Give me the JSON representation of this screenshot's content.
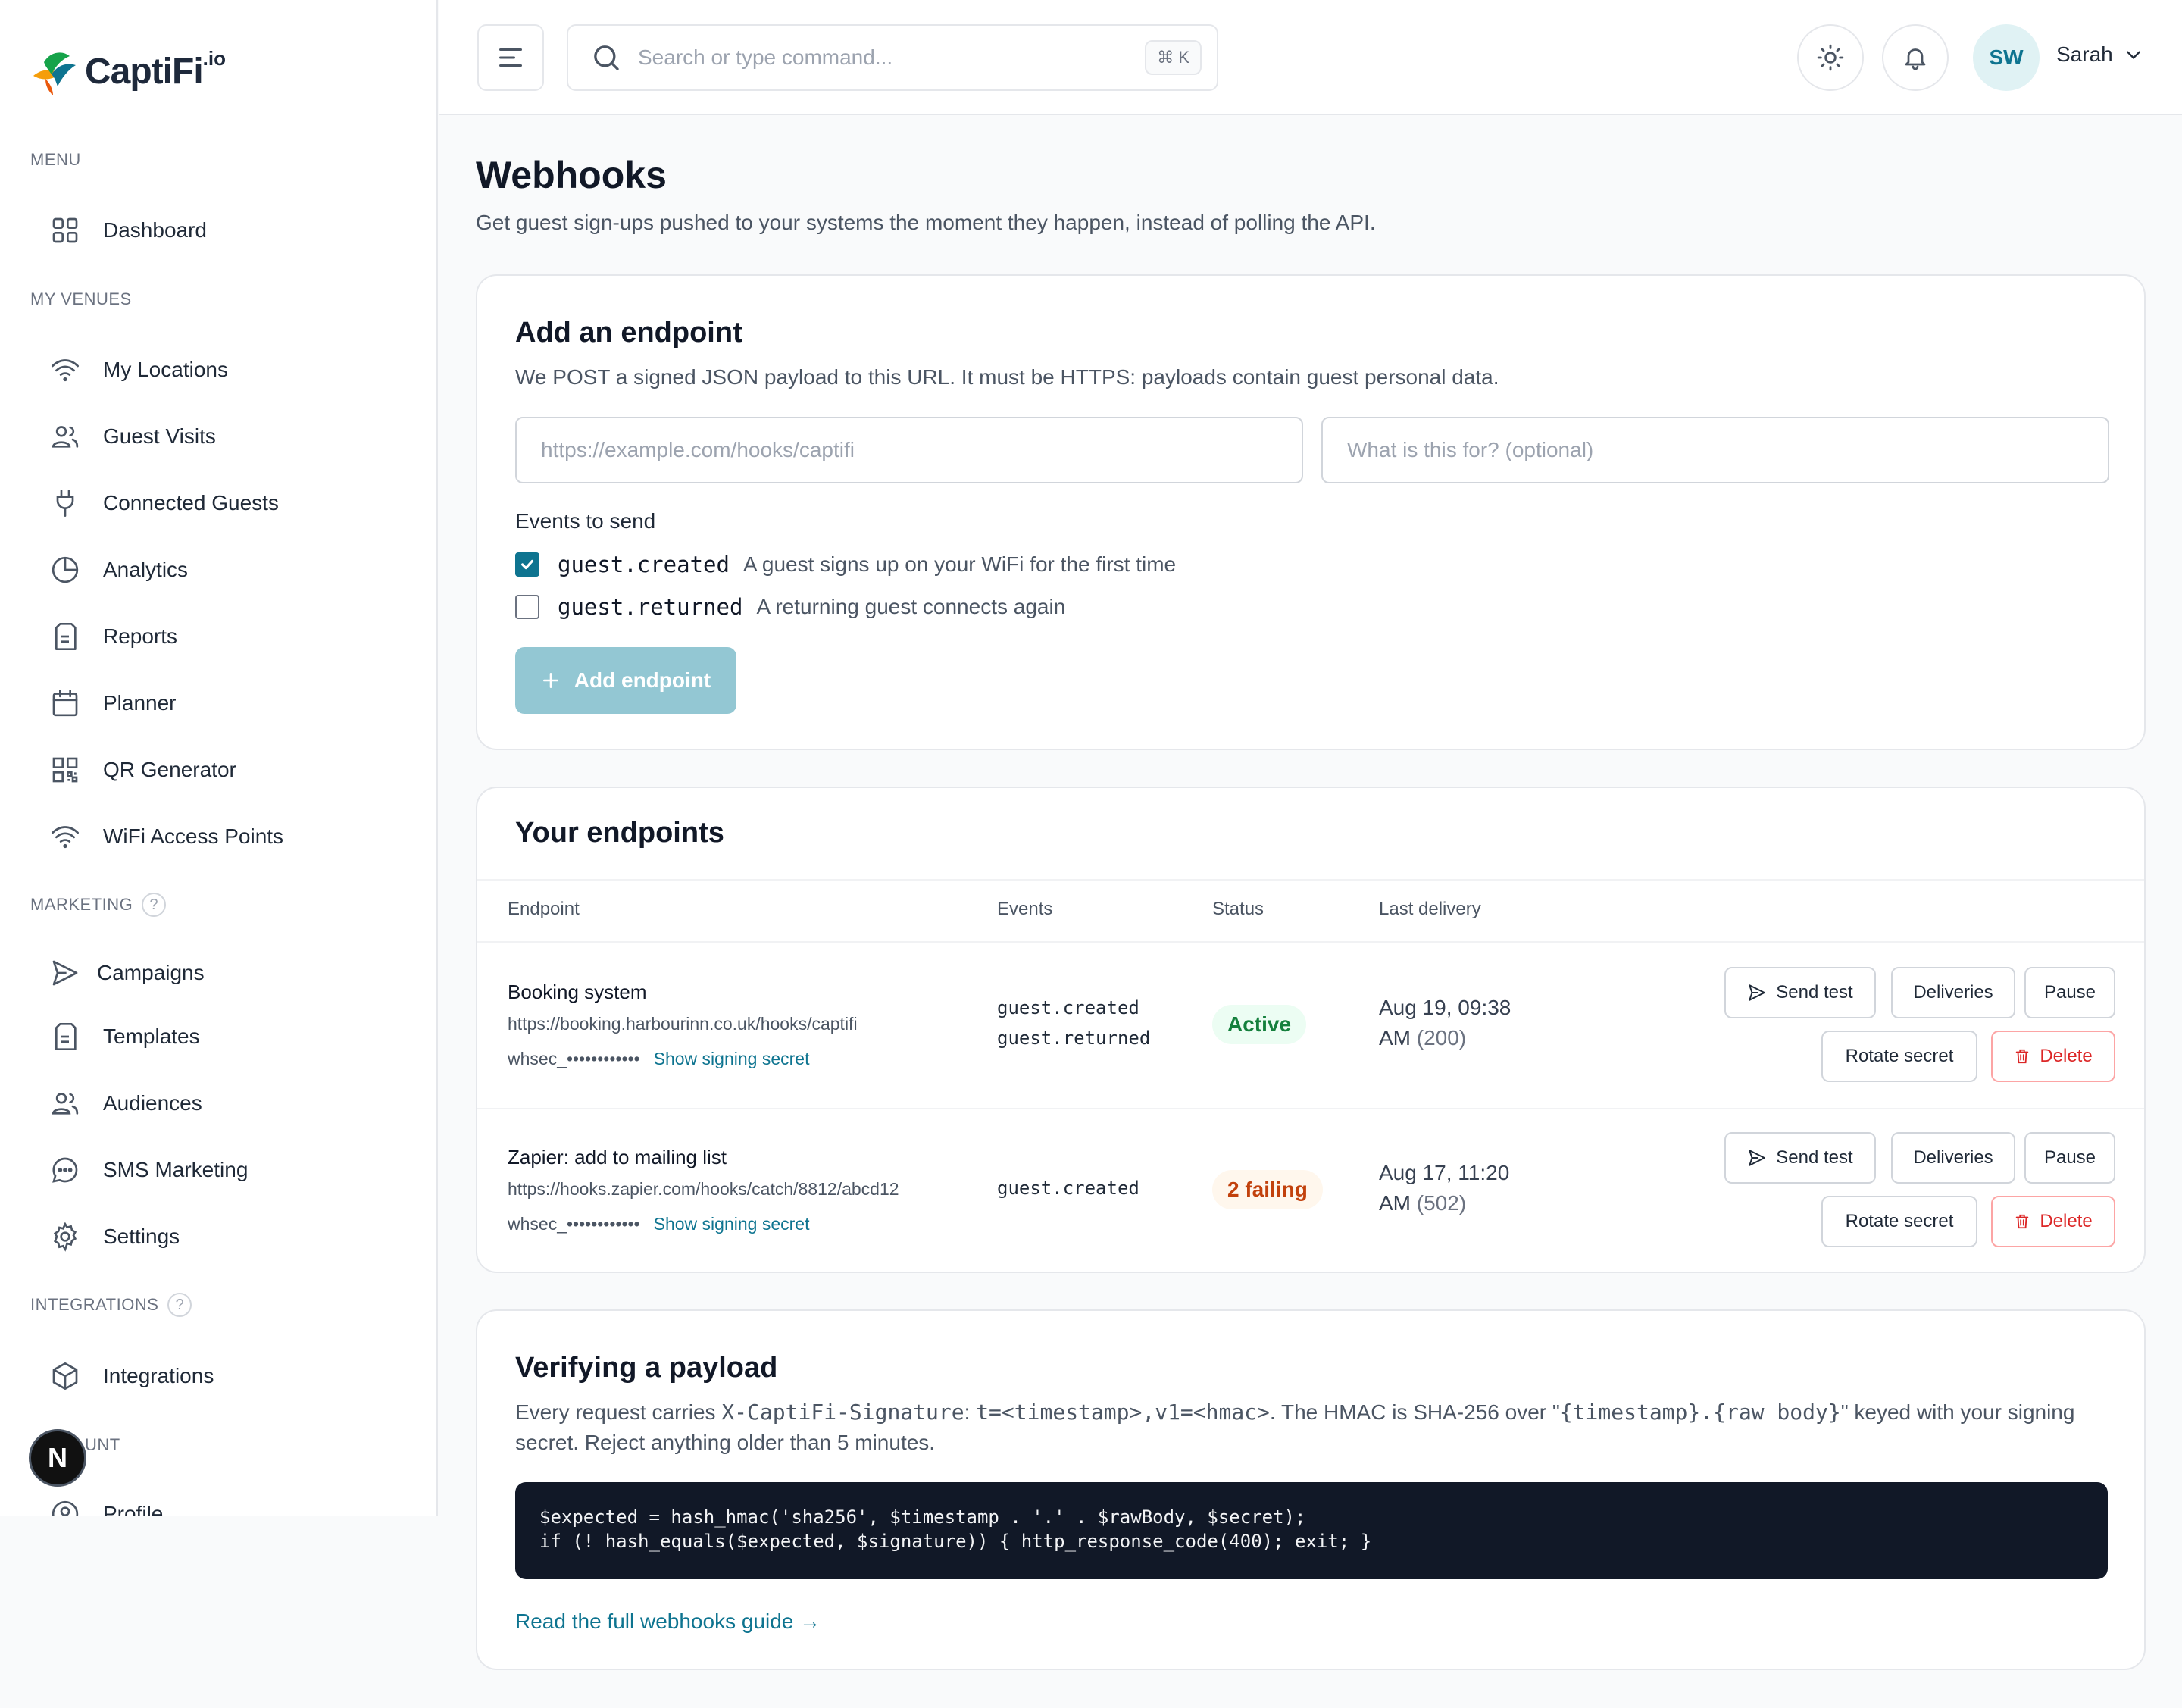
{
  "brand": {
    "name": "CaptiFi",
    "suffix": ".io"
  },
  "sidebar": {
    "sections": {
      "menu": "MENU",
      "venues": "MY VENUES",
      "marketing": "MARKETING",
      "integrations": "INTEGRATIONS",
      "account_partial": "UNT"
    },
    "help_glyph": "?",
    "items": {
      "dashboard": "Dashboard",
      "locations": "My Locations",
      "guest_visits": "Guest Visits",
      "connected": "Connected Guests",
      "analytics": "Analytics",
      "reports": "Reports",
      "planner": "Planner",
      "qr": "QR Generator",
      "access_points": "WiFi Access Points",
      "campaigns": "Campaigns",
      "templates": "Templates",
      "audiences": "Audiences",
      "sms": "SMS Marketing",
      "settings": "Settings",
      "integrations": "Integrations",
      "profile_partial": "Profile"
    },
    "badge": "N"
  },
  "header": {
    "search_placeholder": "Search or type command...",
    "shortcut": "⌘ K",
    "avatar_initials": "SW",
    "user_name": "Sarah"
  },
  "page": {
    "title": "Webhooks",
    "subtitle": "Get guest sign-ups pushed to your systems the moment they happen, instead of polling the API."
  },
  "add_endpoint": {
    "title": "Add an endpoint",
    "description": "We POST a signed JSON payload to this URL. It must be HTTPS: payloads contain guest personal data.",
    "url_placeholder": "https://example.com/hooks/captifi",
    "purpose_placeholder": "What is this for? (optional)",
    "events_label": "Events to send",
    "events": [
      {
        "code": "guest.created",
        "desc": "A guest signs up on your WiFi for the first time",
        "checked": true
      },
      {
        "code": "guest.returned",
        "desc": "A returning guest connects again",
        "checked": false
      }
    ],
    "button": "Add endpoint"
  },
  "endpoints": {
    "title": "Your endpoints",
    "columns": {
      "endpoint": "Endpoint",
      "events": "Events",
      "status": "Status",
      "last_delivery": "Last delivery"
    },
    "rows": [
      {
        "name": "Booking system",
        "url": "https://booking.harbourinn.co.uk/hooks/captifi",
        "secret": "whsec_••••••••••••",
        "show_secret": "Show signing secret",
        "events": [
          "guest.created",
          "guest.returned"
        ],
        "status": "Active",
        "last_delivery_time": "Aug 19, 09:38",
        "last_delivery_ampm": "AM",
        "last_delivery_code": "(200)"
      },
      {
        "name": "Zapier: add to mailing list",
        "url": "https://hooks.zapier.com/hooks/catch/8812/abcd12",
        "secret": "whsec_••••••••••••",
        "show_secret": "Show signing secret",
        "events": [
          "guest.created"
        ],
        "status": "2 failing",
        "last_delivery_time": "Aug 17, 11:20",
        "last_delivery_ampm": "AM",
        "last_delivery_code": "(502)"
      }
    ],
    "actions": {
      "send_test": "Send test",
      "deliveries": "Deliveries",
      "pause": "Pause",
      "rotate": "Rotate secret",
      "delete": "Delete"
    }
  },
  "verify": {
    "title": "Verifying a payload",
    "p1": "Every request carries ",
    "header_code": "X-CaptiFi-Signature",
    "p2": ": ",
    "format_code": "t=<timestamp>,v1=<hmac>",
    "p3": ". The HMAC is SHA-256 over \"",
    "body_code": "{timestamp}.{raw body}",
    "p4": "\" keyed with your signing secret. Reject anything older than 5 minutes.",
    "code_line1": "$expected = hash_hmac('sha256', $timestamp . '.' . $rawBody, $secret);",
    "code_line2": "if (! hash_equals($expected, $signature)) { http_response_code(400); exit; }",
    "link": "Read the full webhooks guide →"
  },
  "colors": {
    "accent": "#0e7490",
    "active": "#15803d",
    "failing": "#c2410c",
    "danger": "#dc2626"
  }
}
